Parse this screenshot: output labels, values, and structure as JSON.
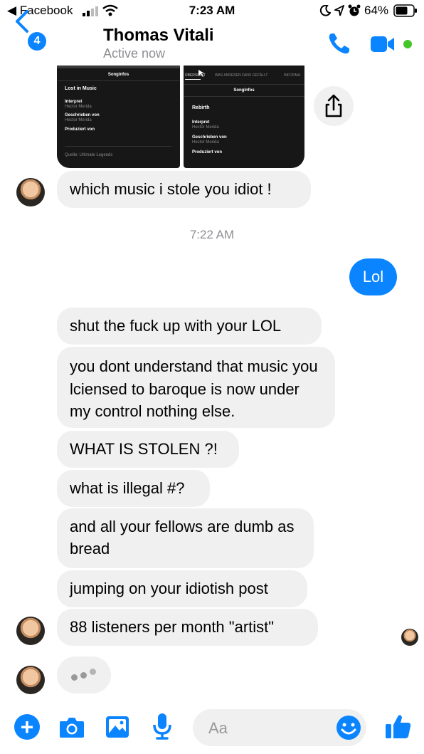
{
  "status_bar": {
    "back_app": "◀ Facebook",
    "time": "7:23 AM",
    "battery": "64%"
  },
  "header": {
    "back_badge": "4",
    "contact_name": "Thomas Vitali",
    "presence": "Active now"
  },
  "screenshots": {
    "left": {
      "section_title": "Songinfos",
      "song": "Lost in Music",
      "interpret_label": "Interpret",
      "interpret_value": "Hector Merida",
      "written_label": "Geschrieben von",
      "written_value": "Hector Merida",
      "produced_label": "Produziert von",
      "source": "Quelle: Ultimate Legends"
    },
    "right": {
      "tabs": [
        "ÜBERSICHT",
        "WAS ANDEREN FANS GEFÄLLT",
        "INFORMA"
      ],
      "section_title": "Songinfos",
      "song": "Rebirth",
      "interpret_label": "Interpret",
      "interpret_value": "Hector Merida",
      "written_label": "Geschrieben von",
      "written_value": "Hector Merida",
      "produced_label": "Produziert von"
    }
  },
  "messages": {
    "m1": "which music i stole you idiot !",
    "timestamp": "7:22 AM",
    "m2_out": "Lol",
    "m3": "shut the fuck up with your LOL",
    "m4": "you dont understand that music you lciensed to baroque is now under my control nothing else.",
    "m5": "WHAT IS STOLEN ?!",
    "m6": "what is illegal #?",
    "m7": "and all your fellows are dumb as bread",
    "m8": "jumping on your idiotish post",
    "m9": "88 listeners per month \"artist\""
  },
  "composer": {
    "placeholder": "Aa"
  },
  "colors": {
    "accent": "#0a84ff",
    "bubble_in": "#f0f0f0",
    "active_green": "#44c52a"
  },
  "icons": [
    "back-triangle-icon",
    "signal-icon",
    "wifi-icon",
    "moon-icon",
    "location-icon",
    "alarm-icon",
    "battery-icon",
    "chevron-left-icon",
    "phone-icon",
    "video-camera-icon",
    "share-icon",
    "plus-icon",
    "camera-icon",
    "image-icon",
    "microphone-icon",
    "emoji-icon",
    "thumbs-up-icon"
  ]
}
